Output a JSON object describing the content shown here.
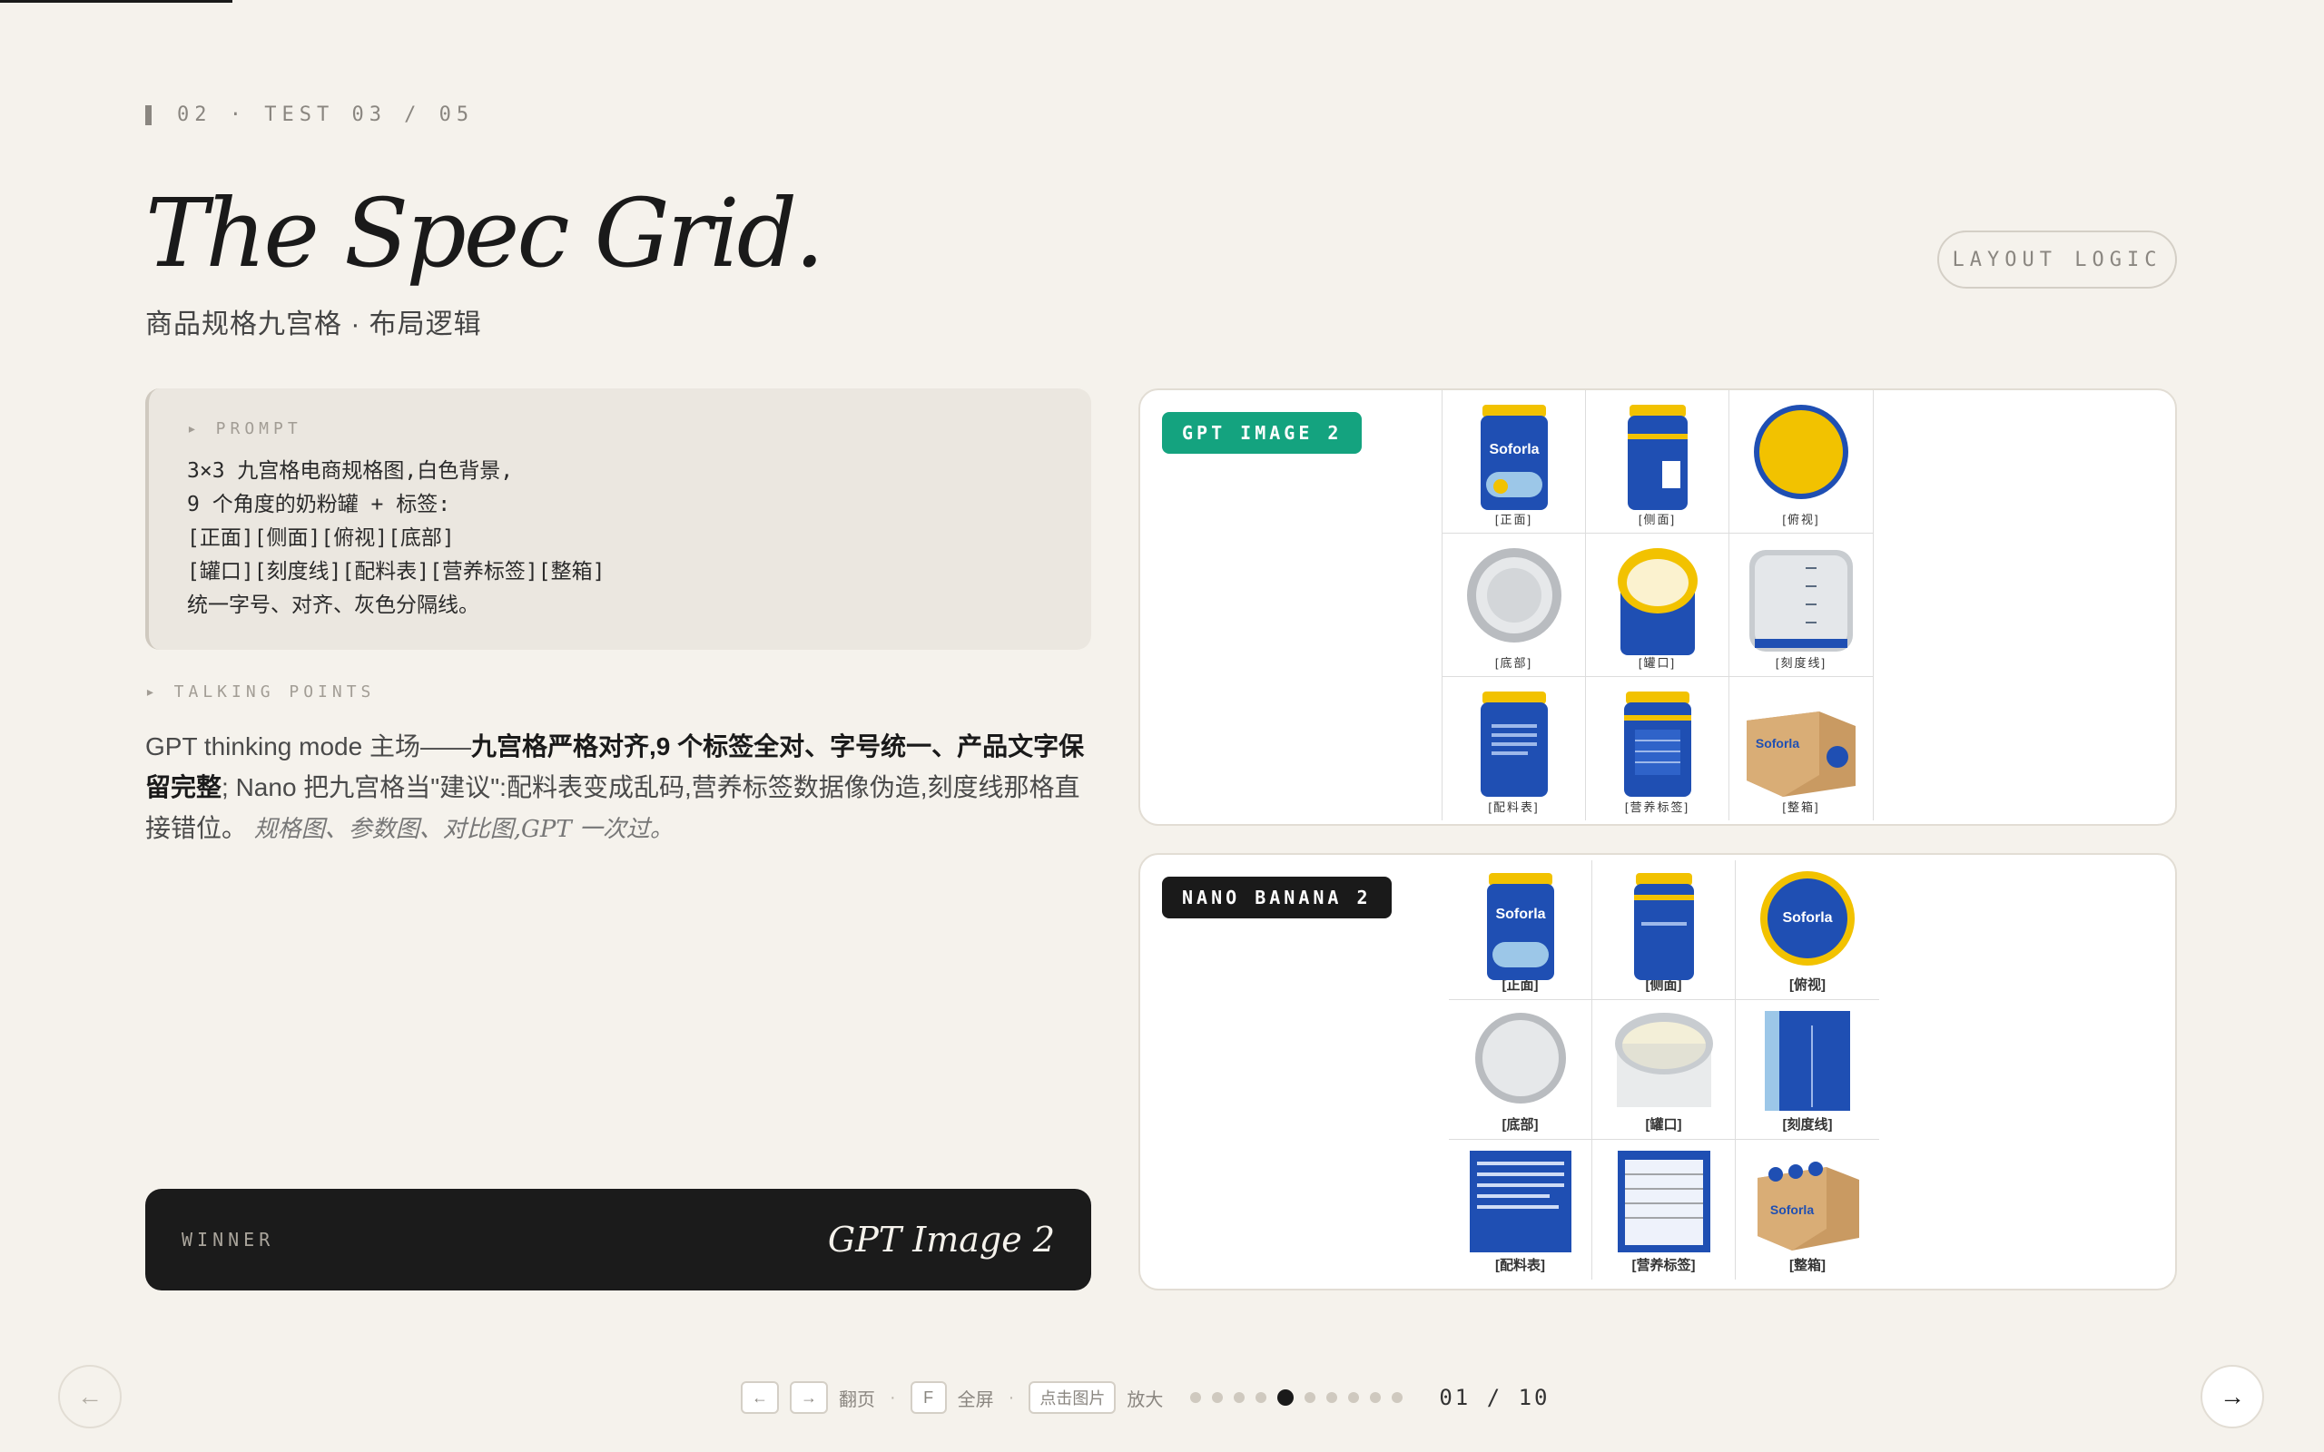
{
  "header": {
    "eyebrow": "02 · TEST 03 / 05",
    "title": "The Spec Grid.",
    "subtitle": "商品规格九宫格 · 布局逻辑",
    "badge": "LAYOUT LOGIC"
  },
  "prompt": {
    "label": "▸ PROMPT",
    "lines": [
      "3×3 九宫格电商规格图,白色背景,",
      "9 个角度的奶粉罐 + 标签:",
      "[正面][侧面][俯视][底部]",
      "[罐口][刻度线][配料表][营养标签][整箱]",
      "统一字号、对齐、灰色分隔线。"
    ]
  },
  "talking": {
    "label": "▸ TALKING POINTS",
    "t1": "GPT thinking mode 主场——",
    "t2": "九宫格严格对齐,9 个标签全对、字号统一、产品文字保留完整",
    "t3": "; Nano 把九宫格当\"建议\":配料表变成乱码,营养标签数据像伪造,刻度线那格直接错位。",
    "t4": "规格图、参数图、对比图,GPT 一次过。"
  },
  "winner": {
    "label": "WINNER",
    "value": "GPT Image 2"
  },
  "panels": {
    "gpt": {
      "tag": "GPT IMAGE 2",
      "labels": [
        "[正面]",
        "[侧面]",
        "[俯视]",
        "[底部]",
        "[罐口]",
        "[刻度线]",
        "[配料表]",
        "[营养标签]",
        "[整箱]"
      ]
    },
    "nano": {
      "tag": "NANO BANANA 2",
      "labels": [
        "[正面]",
        "[侧面]",
        "[俯视]",
        "[底部]",
        "[罐口]",
        "[刻度线]",
        "[配料表]",
        "[营养标签]",
        "[整箱]"
      ]
    }
  },
  "footer": {
    "prev_key": "←",
    "next_key": "→",
    "page_label": "翻页",
    "f_key": "F",
    "fullscreen_label": "全屏",
    "click_key": "点击图片",
    "zoom_label": "放大",
    "counter": "01 / 10",
    "dots_total": 10,
    "dots_active": 5
  },
  "colors": {
    "background": "#f5f2ec",
    "gpt_tag": "#14a37f",
    "nano_tag": "#1a1a1a",
    "can_blue": "#1f4fb3",
    "can_yellow": "#f2c200"
  },
  "icons": {
    "prev": "arrow-left-icon",
    "next": "arrow-right-icon"
  }
}
